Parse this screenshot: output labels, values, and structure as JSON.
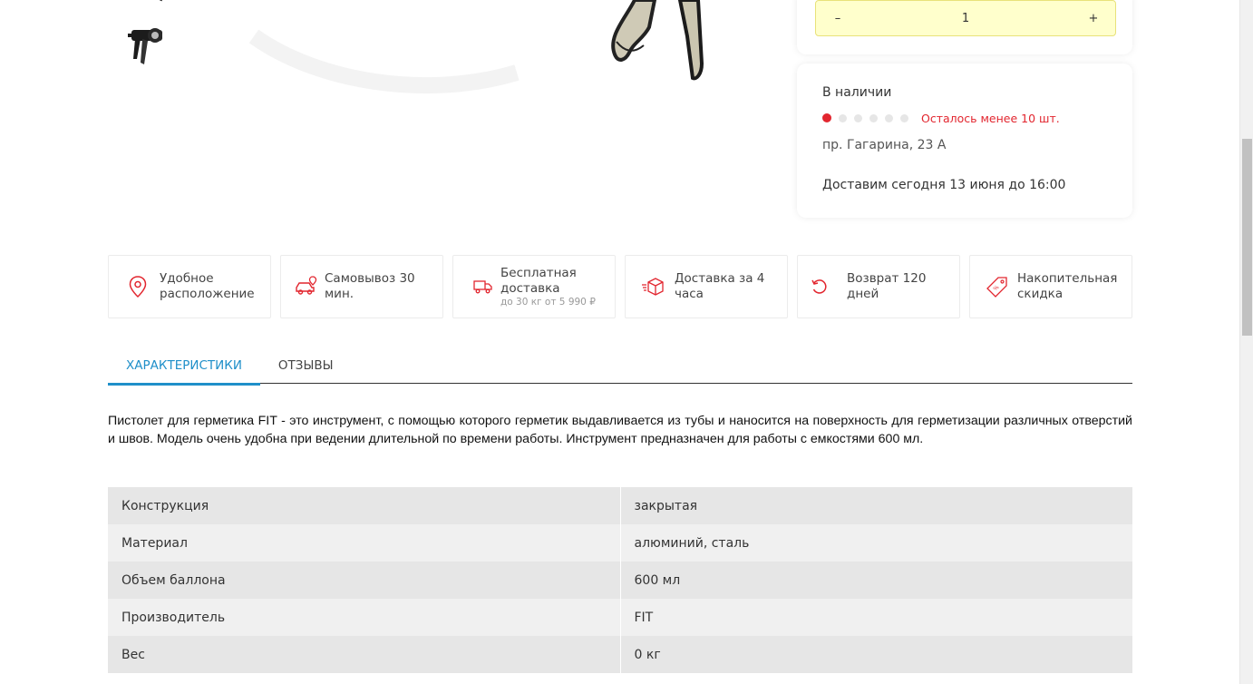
{
  "quantity": {
    "minus": "–",
    "value": "1",
    "plus": "+"
  },
  "stock": {
    "title": "В наличии",
    "level_filled": 1,
    "level_total": 6,
    "warning": "Осталось менее 10 шт.",
    "address": "пр. Гагарина, 23 А",
    "delivery": "Доставим сегодня 13 июня до 16:00",
    "warning_color": "#e2262f"
  },
  "features": [
    {
      "icon": "map-pin-icon",
      "title": "Удобное расположение",
      "sub": ""
    },
    {
      "icon": "car-pickup-icon",
      "title": "Самовывоз 30 мин.",
      "sub": ""
    },
    {
      "icon": "truck-free-icon",
      "title": "Бесплатная доставка",
      "sub": "до 30 кг от 5 990 ₽"
    },
    {
      "icon": "box-delivery-icon",
      "title": "Доставка за 4 часа",
      "sub": ""
    },
    {
      "icon": "return-icon",
      "title": "Возврат 120 дней",
      "sub": ""
    },
    {
      "icon": "discount-tag-icon",
      "title": "Накопительная скидка",
      "sub": ""
    }
  ],
  "tabs": [
    {
      "label": "Характеристики",
      "active": true
    },
    {
      "label": "Отзывы",
      "active": false
    }
  ],
  "description": "Пистолет для герметика FIT - это инструмент, с помощью которого герметик выдавливается из тубы и наносится на поверхность для герметизации различных отверстий и швов. Модель очень удобна при ведении длительной по времени работы. Инструмент предназначен для работы с емкостями 600 мл.",
  "specs": [
    {
      "key": "Конструкция",
      "value": "закрытая"
    },
    {
      "key": "Материал",
      "value": "алюминий, сталь"
    },
    {
      "key": "Объем баллона",
      "value": "600 мл"
    },
    {
      "key": "Производитель",
      "value": "FIT"
    },
    {
      "key": "Вес",
      "value": "0 кг"
    }
  ],
  "colors": {
    "accent": "#1f8fc9",
    "icon_red": "#e2262f",
    "qty_bg": "#ffffcc"
  }
}
